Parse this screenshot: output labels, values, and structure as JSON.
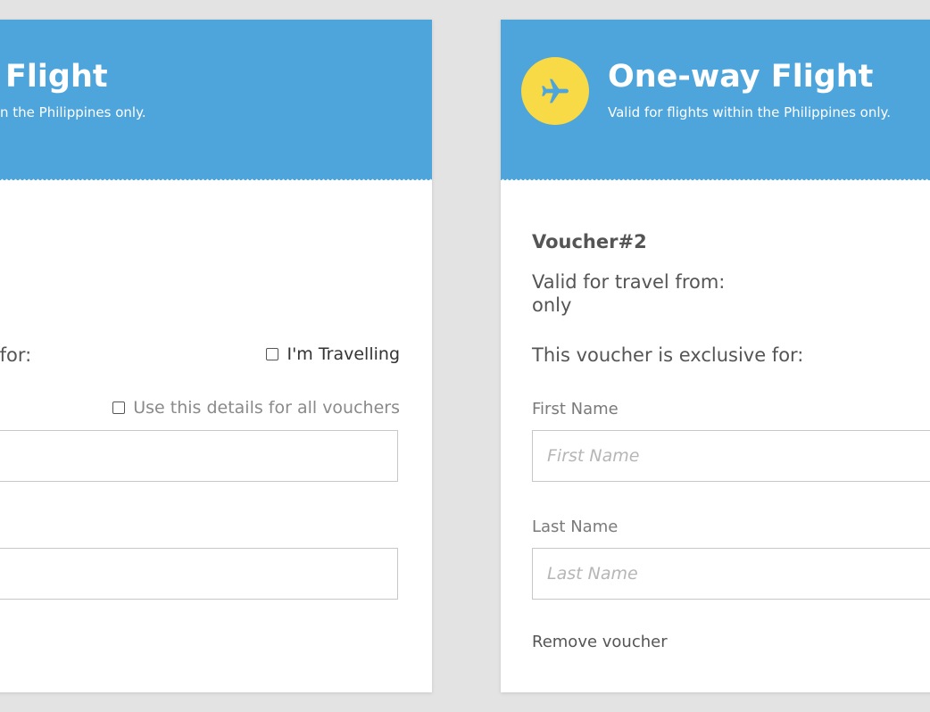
{
  "colors": {
    "page_background": "#e3e3e3",
    "header_blue": "#4ea5dc",
    "badge_yellow": "#f8d946",
    "text_dark": "#555555"
  },
  "voucher_left": {
    "title": "Flight",
    "subtitle": "n the Philippines only.",
    "exclusive_label": "e for:",
    "traveller_checkbox_label": "I'm Travelling",
    "traveller_checked": false,
    "apply_all_checkbox_label": "Use this details for all vouchers",
    "apply_all_checked": false,
    "first_name_value": "",
    "last_name_value": ""
  },
  "voucher_right": {
    "icon": "airplane-icon",
    "title": "One-way Flight",
    "subtitle": "Valid for flights within the Philippines only.",
    "voucher_number": "Voucher#2",
    "valid_travel_label": "Valid for travel from:",
    "valid_travel_suffix": "only",
    "exclusive_label": "This voucher is exclusive for:",
    "first_name_label": "First Name",
    "first_name_placeholder": "First Name",
    "first_name_value": "",
    "last_name_label": "Last Name",
    "last_name_placeholder": "Last Name",
    "last_name_value": "",
    "remove_label": "Remove voucher"
  }
}
